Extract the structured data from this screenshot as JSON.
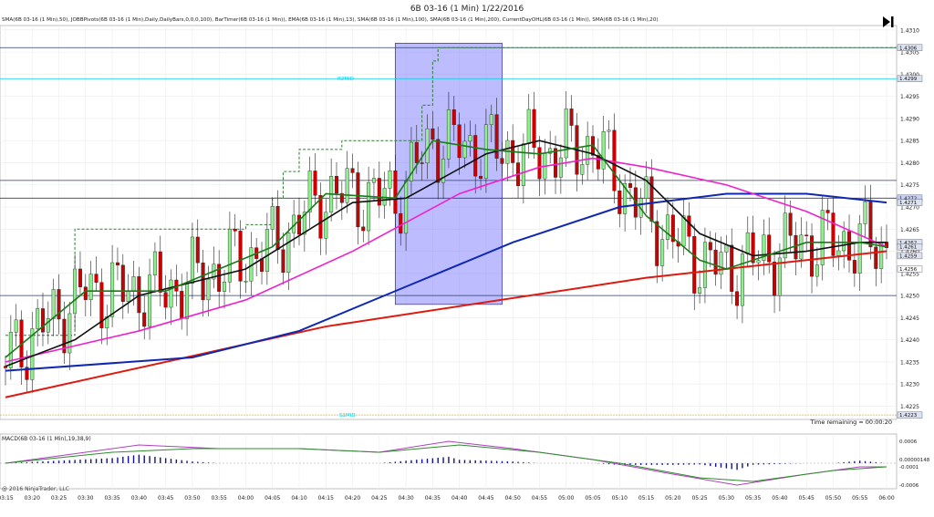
{
  "window": {
    "title": "6B 03-16 (1 Min)  1/22/2016",
    "indicators_line": "SMA(6B 03-16 (1 Min),50), JOBBPivots(6B 03-16 (1 Min),Daily,DailyBars,0,0,0,100), BarTimer(6B 03-16 (1 Min)), EMA(6B 03-16 (1 Min),13), SMA(6B 03-16 (1 Min),100), SMA(6B 03-16 (1 Min),200), CurrentDayOHL(6B 03-16 (1 Min)), SMA(6B 03-16 (1 Min),20)",
    "time_remaining": "Time remaining = 00:00:20",
    "copyright": "@ 2016 NinjaTrader, LLC",
    "scroll_icon": "play-to-end-icon"
  },
  "colors": {
    "candle_up": "#90ee90",
    "candle_down": "#cc0000",
    "ema13": "#1a7a1a",
    "sma20": "#111111",
    "sma50": "#ee22cc",
    "sma100": "#1028b0",
    "sma200": "#dd1a10",
    "pivot": "#00ccee",
    "high_low": "#2e7d32",
    "highlight": "#6b6bff",
    "macd": "#b040c0",
    "macd_signal": "#2e8b2e",
    "macd_hist": "#10108a"
  },
  "chart_data": [
    {
      "type": "candlestick",
      "instrument": "6B 03-16",
      "interval": "1 Min",
      "date": "1/22/2016",
      "ylim": [
        1.4222,
        1.4311
      ],
      "y_ticks": [
        "1.4225",
        "1.4230",
        "1.4235",
        "1.4240",
        "1.4245",
        "1.4250",
        "1.4255",
        "1.4260",
        "1.4265",
        "1.4270",
        "1.4275",
        "1.4280",
        "1.4285",
        "1.4290",
        "1.4295",
        "1.4300",
        "1.4305",
        "1.4310"
      ],
      "x_ticks": [
        "03:15",
        "03:20",
        "03:25",
        "03:30",
        "03:35",
        "03:40",
        "03:45",
        "03:50",
        "03:55",
        "04:00",
        "04:05",
        "04:10",
        "04:15",
        "04:20",
        "04:25",
        "04:30",
        "04:35",
        "04:40",
        "04:45",
        "04:50",
        "04:55",
        "05:00",
        "05:05",
        "05:10",
        "05:15",
        "05:20",
        "05:25",
        "05:30",
        "05:35",
        "05:40",
        "05:45",
        "05:50",
        "05:55",
        "06:00"
      ],
      "price_labels": [
        {
          "value": 1.4306,
          "text": "1.4306",
          "kind": "high"
        },
        {
          "value": 1.4299,
          "text": "1.4299",
          "kind": "pivot"
        },
        {
          "value": 1.4272,
          "text": "1.4272",
          "kind": "sma100"
        },
        {
          "value": 1.4271,
          "text": "1.4271",
          "kind": "pivot"
        },
        {
          "value": 1.4262,
          "text": "1.4262",
          "kind": "sma20"
        },
        {
          "value": 1.4261,
          "text": "1.4261",
          "kind": "ema13"
        },
        {
          "value": 1.4259,
          "text": "1.4259",
          "kind": "sma50"
        },
        {
          "value": 1.4256,
          "text": "1.4256",
          "kind": "close"
        },
        {
          "value": 1.4223,
          "text": "1.4223",
          "kind": "low"
        }
      ],
      "pivot_labels": [
        {
          "value": 1.4299,
          "text": "R2MID"
        },
        {
          "value": 1.4223,
          "text": "S1MID"
        }
      ],
      "horizontal_lines": [
        1.4306,
        1.4276,
        1.4272,
        1.425
      ],
      "highlight_zone": {
        "x_start": "04:28",
        "x_end": "04:48",
        "y_low": 1.4248,
        "y_high": 1.4307
      },
      "day_high_steps": [
        {
          "t": "03:15",
          "v": 1.4241
        },
        {
          "t": "03:28",
          "v": 1.4265
        },
        {
          "t": "04:00",
          "v": 1.4266
        },
        {
          "t": "04:05",
          "v": 1.4272
        },
        {
          "t": "04:07",
          "v": 1.4278
        },
        {
          "t": "04:10",
          "v": 1.4283
        },
        {
          "t": "04:18",
          "v": 1.4285
        },
        {
          "t": "04:33",
          "v": 1.4293
        },
        {
          "t": "04:35",
          "v": 1.4303
        },
        {
          "t": "04:36",
          "v": 1.4306
        }
      ],
      "series": [
        {
          "name": "SMA 200",
          "color_key": "sma200",
          "points": [
            [
              "03:15",
              1.4227
            ],
            [
              "04:15",
              1.4243
            ],
            [
              "05:15",
              1.4254
            ],
            [
              "06:00",
              1.426
            ]
          ]
        },
        {
          "name": "SMA 100",
          "color_key": "sma100",
          "points": [
            [
              "03:15",
              1.4233
            ],
            [
              "03:50",
              1.4236
            ],
            [
              "04:10",
              1.4242
            ],
            [
              "04:30",
              1.4252
            ],
            [
              "04:50",
              1.4262
            ],
            [
              "05:10",
              1.427
            ],
            [
              "05:30",
              1.4273
            ],
            [
              "05:45",
              1.4273
            ],
            [
              "06:00",
              1.4271
            ]
          ]
        },
        {
          "name": "SMA 50",
          "color_key": "sma50",
          "points": [
            [
              "03:15",
              1.4235
            ],
            [
              "03:40",
              1.4242
            ],
            [
              "04:00",
              1.4249
            ],
            [
              "04:20",
              1.426
            ],
            [
              "04:40",
              1.4273
            ],
            [
              "04:55",
              1.4279
            ],
            [
              "05:05",
              1.4281
            ],
            [
              "05:15",
              1.4279
            ],
            [
              "05:30",
              1.4275
            ],
            [
              "05:45",
              1.4269
            ],
            [
              "06:00",
              1.4261
            ]
          ]
        },
        {
          "name": "SMA 20",
          "color_key": "sma20",
          "points": [
            [
              "03:15",
              1.4234
            ],
            [
              "03:28",
              1.424
            ],
            [
              "03:40",
              1.425
            ],
            [
              "04:00",
              1.4256
            ],
            [
              "04:20",
              1.4271
            ],
            [
              "04:30",
              1.4272
            ],
            [
              "04:45",
              1.4282
            ],
            [
              "04:55",
              1.4285
            ],
            [
              "05:05",
              1.4282
            ],
            [
              "05:15",
              1.4276
            ],
            [
              "05:25",
              1.4264
            ],
            [
              "05:35",
              1.4259
            ],
            [
              "05:45",
              1.426
            ],
            [
              "05:55",
              1.4262
            ],
            [
              "06:00",
              1.4262
            ]
          ]
        },
        {
          "name": "EMA 13",
          "color_key": "ema13",
          "points": [
            [
              "03:15",
              1.4236
            ],
            [
              "03:30",
              1.4251
            ],
            [
              "03:45",
              1.4251
            ],
            [
              "04:05",
              1.4261
            ],
            [
              "04:15",
              1.4273
            ],
            [
              "04:28",
              1.4272
            ],
            [
              "04:35",
              1.4285
            ],
            [
              "04:45",
              1.4283
            ],
            [
              "04:55",
              1.4282
            ],
            [
              "05:05",
              1.4284
            ],
            [
              "05:15",
              1.4268
            ],
            [
              "05:25",
              1.4258
            ],
            [
              "05:30",
              1.4256
            ],
            [
              "05:45",
              1.4262
            ],
            [
              "05:55",
              1.4262
            ],
            [
              "06:00",
              1.4261
            ]
          ]
        }
      ]
    },
    {
      "type": "macd",
      "title": "MACD(6B 03-16 (1 Min),19,38,9)",
      "ylim": [
        -0.0007,
        0.0008
      ],
      "y_labels": [
        {
          "value": 0.0006,
          "text": "0.0006"
        },
        {
          "value": 0.0,
          "text": "0.0000"
        },
        {
          "value": 1.48e-06,
          "text": "0.00000148"
        },
        {
          "value": -1e-05,
          "text": "-0.0001"
        },
        {
          "value": -0.0006,
          "text": "-0.0006"
        }
      ],
      "macd": [
        [
          "03:15",
          0.0
        ],
        [
          "03:30",
          0.0003
        ],
        [
          "03:40",
          0.0005
        ],
        [
          "03:55",
          0.0004
        ],
        [
          "04:10",
          0.0004
        ],
        [
          "04:25",
          0.0003
        ],
        [
          "04:38",
          0.0006
        ],
        [
          "04:50",
          0.0004
        ],
        [
          "05:05",
          0.0001
        ],
        [
          "05:20",
          -0.0003
        ],
        [
          "05:32",
          -0.0006
        ],
        [
          "05:45",
          -0.0003
        ],
        [
          "05:55",
          -0.0001
        ],
        [
          "06:00",
          -0.0001
        ]
      ],
      "signal": [
        [
          "03:15",
          0.0
        ],
        [
          "03:35",
          0.0003
        ],
        [
          "03:50",
          0.0004
        ],
        [
          "04:10",
          0.0004
        ],
        [
          "04:25",
          0.0003
        ],
        [
          "04:40",
          0.0005
        ],
        [
          "04:55",
          0.0003
        ],
        [
          "05:10",
          0.0
        ],
        [
          "05:25",
          -0.0004
        ],
        [
          "05:35",
          -0.0005
        ],
        [
          "05:50",
          -0.0002
        ],
        [
          "06:00",
          -0.0001
        ]
      ]
    }
  ]
}
